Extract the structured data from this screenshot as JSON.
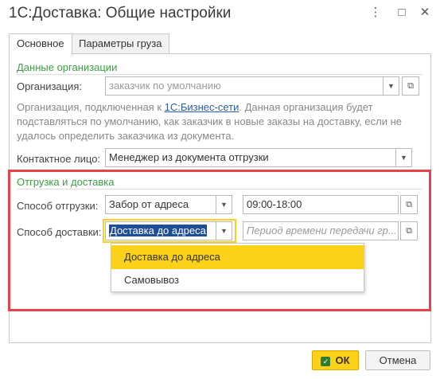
{
  "window": {
    "title": "1С:Доставка: Общие настройки",
    "more_icon": "⋮",
    "maximize_icon": "□",
    "close_icon": "✕"
  },
  "tabs": [
    {
      "label": "Основное",
      "active": true
    },
    {
      "label": "Параметры груза",
      "active": false
    }
  ],
  "org_section": {
    "heading": "Данные организации",
    "org_label": "Организация:",
    "org_placeholder": "заказчик по умолчанию",
    "desc_before": "Организация, подключенная к ",
    "desc_link": "1С:Бизнес-сети",
    "desc_after": ". Данная организация будет подставляться по умолчанию, как заказчик в новые заказы на доставку, если не удалось определить заказчика из документа.",
    "contact_label": "Контактное лицо:",
    "contact_value": "Менеджер из документа отгрузки"
  },
  "shipping_section": {
    "heading": "Отгрузка и доставка",
    "ship_method_label": "Способ отгрузки:",
    "ship_method_value": "Забор от адреса",
    "ship_time_value": "09:00-18:00",
    "delivery_method_label": "Способ доставки:",
    "delivery_method_value": "Доставка до адреса",
    "delivery_period_placeholder": "Период времени передачи гр..."
  },
  "dropdown": {
    "options": [
      "Доставка до адреса",
      "Самовывоз"
    ],
    "selected": "Доставка до адреса"
  },
  "footer": {
    "ok_label": "ОК",
    "cancel_label": "Отмена"
  },
  "colors": {
    "accent_yellow": "#fcd119",
    "section_green": "#3aa042",
    "highlight_red": "#e7434a",
    "link_blue": "#2a5fa8"
  }
}
